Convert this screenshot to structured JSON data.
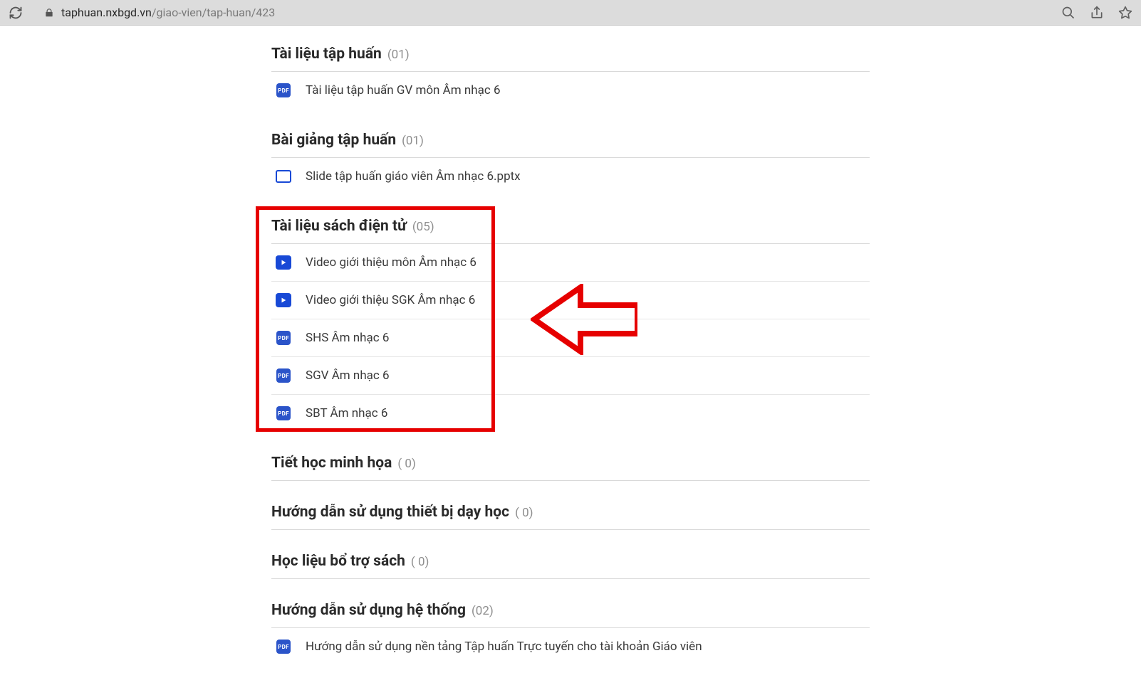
{
  "browser": {
    "url_host": "taphuan.nxbgd.vn",
    "url_path": "/giao-vien/tap-huan/423"
  },
  "sections": [
    {
      "title": "Tài liệu tập huấn",
      "count": "(01)",
      "items": [
        {
          "icon": "pdf",
          "label": "Tài liệu tập huấn GV môn Âm nhạc 6"
        }
      ]
    },
    {
      "title": "Bài giảng tập huấn",
      "count": "(01)",
      "items": [
        {
          "icon": "slide",
          "label": "Slide tập huấn giáo viên Âm nhạc 6.pptx"
        }
      ]
    },
    {
      "title": "Tài liệu sách điện tử",
      "count": "(05)",
      "items": [
        {
          "icon": "video",
          "label": "Video giới thiệu môn Âm nhạc 6"
        },
        {
          "icon": "video",
          "label": "Video giới thiệu SGK Âm nhạc 6"
        },
        {
          "icon": "pdf",
          "label": "SHS Âm nhạc 6"
        },
        {
          "icon": "pdf",
          "label": "SGV Âm nhạc 6"
        },
        {
          "icon": "pdf",
          "label": "SBT Âm nhạc 6"
        }
      ]
    },
    {
      "title": "Tiết học minh họa",
      "count": "( 0)",
      "items": []
    },
    {
      "title": "Hướng dẫn sử dụng thiết bị dạy học",
      "count": "( 0)",
      "items": []
    },
    {
      "title": "Học liệu bổ trợ sách",
      "count": "( 0)",
      "items": []
    },
    {
      "title": "Hướng dẫn sử dụng hệ thống",
      "count": "(02)",
      "items": [
        {
          "icon": "pdf",
          "label": "Hướng dẫn sử dụng nền tảng Tập huấn Trực tuyến cho tài khoản Giáo viên"
        }
      ]
    }
  ],
  "pdf_badge_text": "PDF",
  "annotation": {
    "highlight_section_index": 2
  }
}
